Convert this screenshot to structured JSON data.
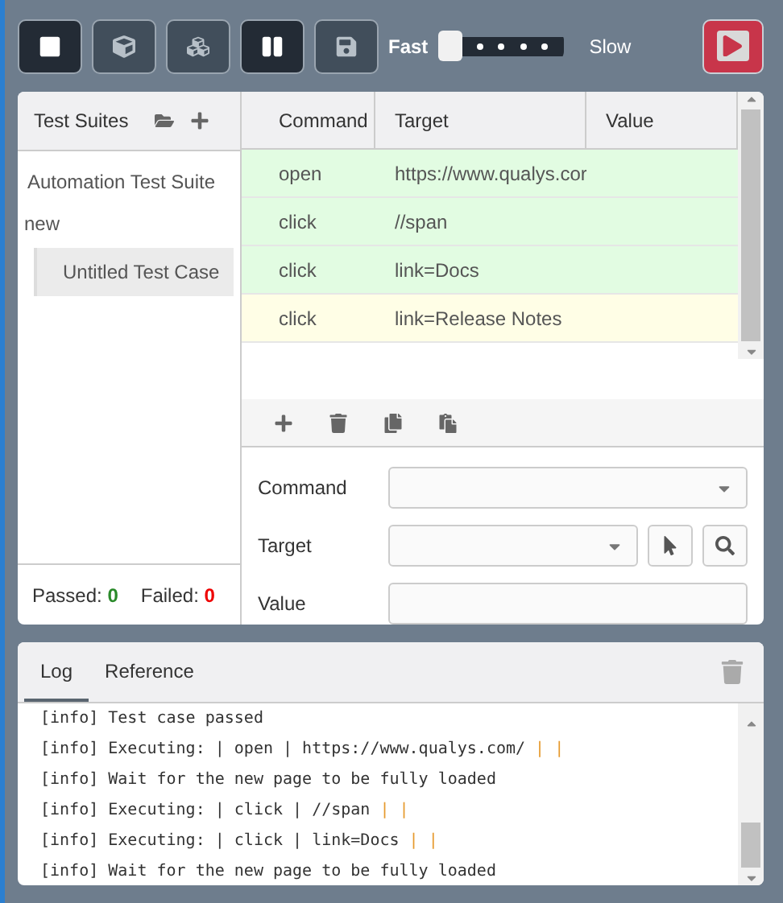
{
  "toolbar": {
    "buttons": [
      {
        "kind": "stop",
        "selected": true
      },
      {
        "kind": "cube",
        "selected": false
      },
      {
        "kind": "cubes",
        "selected": false
      },
      {
        "kind": "pause",
        "selected": true
      },
      {
        "kind": "save",
        "selected": false
      }
    ],
    "speed": {
      "fast_label": "Fast",
      "slow_label": "Slow",
      "level": 0
    },
    "record_button": {
      "active": true
    }
  },
  "sidebar": {
    "title": "Test Suites",
    "suites": [
      {
        "name": "Automation Test Suite"
      },
      {
        "name": "new",
        "cases": [
          {
            "name": "Untitled Test Case",
            "selected": true
          }
        ]
      }
    ],
    "passed_label": "Passed:",
    "passed": "0",
    "failed_label": "Failed:",
    "failed": "0"
  },
  "table": {
    "columns": [
      "Command",
      "Target",
      "Value"
    ],
    "rows": [
      {
        "command": "open",
        "target": "https://www.qualys.cor",
        "color": "#e2fce2"
      },
      {
        "command": "click",
        "target": "//span",
        "color": "#e2fce2"
      },
      {
        "command": "click",
        "target": "link=Docs",
        "color": "#e2fce2"
      },
      {
        "command": "click",
        "target": "link=Release Notes",
        "color": "#fffee6"
      }
    ]
  },
  "editor": {
    "fields": [
      {
        "label": "Command",
        "kind": "select"
      },
      {
        "label": "Target",
        "kind": "target"
      },
      {
        "label": "Value",
        "kind": "text"
      }
    ]
  },
  "log": {
    "tabs": [
      {
        "label": "Log",
        "selected": true
      },
      {
        "label": "Reference",
        "selected": false
      }
    ],
    "lines": [
      {
        "text": "[info] Test case passed"
      },
      {
        "text": "[info] Executing: | open | https://www.qualys.com/ ",
        "tail": "| |"
      },
      {
        "text": "[info] Wait for the new page to be fully loaded"
      },
      {
        "text": "[info] Executing: | click | //span ",
        "tail": "| |"
      },
      {
        "text": "[info] Executing: | click | link=Docs ",
        "tail": "| |"
      },
      {
        "text": "[info] Wait for the new page to be fully loaded"
      }
    ]
  }
}
